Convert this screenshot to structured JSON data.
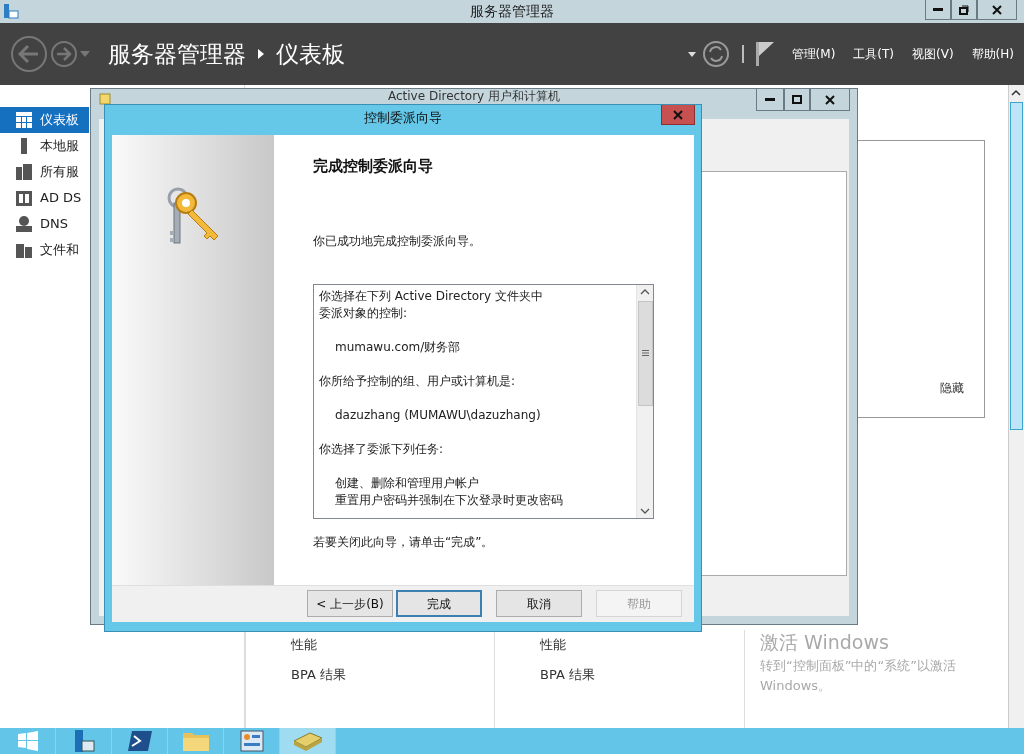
{
  "window": {
    "title": "服务器管理器"
  },
  "header": {
    "breadcrumb": [
      "服务器管理器",
      "仪表板"
    ],
    "menus": [
      "管理(M)",
      "工具(T)",
      "视图(V)",
      "帮助(H)"
    ]
  },
  "sidebar": {
    "items": [
      {
        "label": "仪表板",
        "kind": "dashboard",
        "selected": true
      },
      {
        "label": "本地服",
        "kind": "server",
        "selected": false
      },
      {
        "label": "所有服",
        "kind": "servers",
        "selected": false
      },
      {
        "label": "AD DS",
        "kind": "role",
        "selected": false
      },
      {
        "label": "DNS",
        "kind": "dns",
        "selected": false
      },
      {
        "label": "文件和",
        "kind": "files",
        "selected": false
      }
    ]
  },
  "panel": {
    "hide_link": "隐藏"
  },
  "tiles": [
    {
      "rows": [
        "性能",
        "BPA 结果"
      ]
    },
    {
      "rows": [
        "性能",
        "BPA 结果"
      ]
    }
  ],
  "activation": {
    "title": "激活 Windows",
    "text": "转到“控制面板”中的“系统”以激活 Windows。"
  },
  "ad_window": {
    "title": "Active Directory 用户和计算机"
  },
  "wizard": {
    "title": "控制委派向导",
    "heading": "完成控制委派向导",
    "intro": "你已成功地完成控制委派向导。",
    "summary": [
      {
        "kind": "heading",
        "text": "你选择在下列 Active Directory 文件夹中"
      },
      {
        "kind": "heading",
        "text": "委派对象的控制:"
      },
      {
        "kind": "item",
        "text": "mumawu.com/财务部"
      },
      {
        "kind": "heading",
        "text": "你所给予控制的组、用户或计算机是:"
      },
      {
        "kind": "item",
        "text": "dazuzhang (MUMAWU\\dazuzhang)"
      },
      {
        "kind": "heading",
        "text": "你选择了委派下列任务:"
      },
      {
        "kind": "item",
        "text": "创建、删除和管理用户帐户"
      },
      {
        "kind": "item",
        "text": "重置用户密码并强制在下次登录时更改密码"
      }
    ],
    "footer_note": "若要关闭此向导，请单击“完成”。",
    "buttons": [
      {
        "label": "< 上一步(B)",
        "default": false,
        "disabled": false
      },
      {
        "label": "完成",
        "default": true,
        "disabled": false
      },
      {
        "label": "取消",
        "default": false,
        "disabled": false
      },
      {
        "label": "帮助",
        "default": false,
        "disabled": true
      }
    ]
  }
}
